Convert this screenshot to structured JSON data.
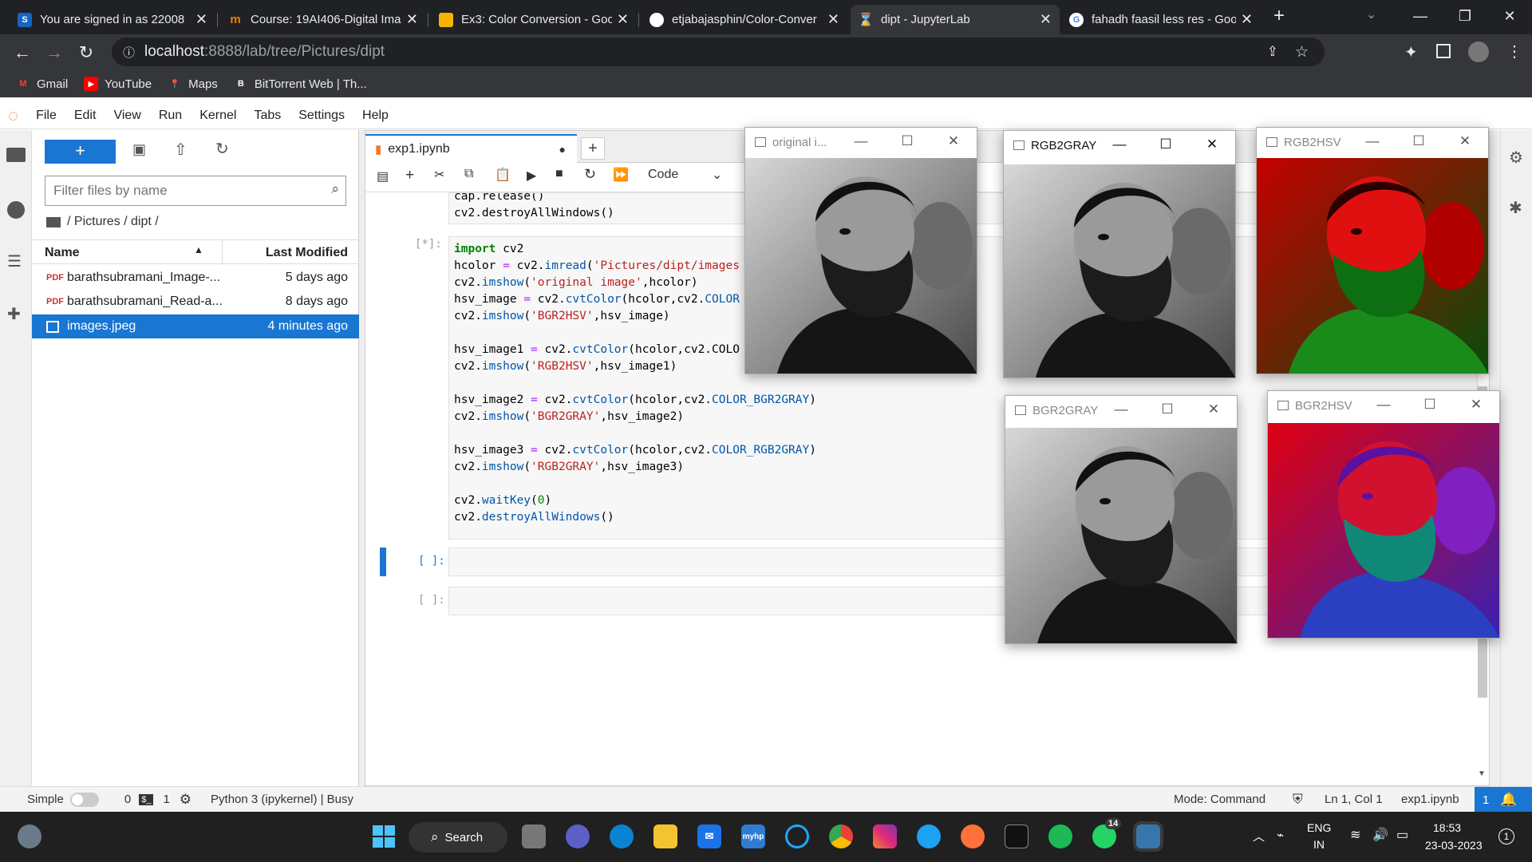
{
  "browser": {
    "tabs": [
      {
        "title": "You are signed in as 22008",
        "favicon": "S",
        "color": "#1565c0",
        "active": false
      },
      {
        "title": "Course: 19AI406-Digital Ima",
        "favicon": "m",
        "color": "#f57c00",
        "active": false
      },
      {
        "title": "Ex3: Color Conversion - Goo",
        "favicon": "",
        "color": "#f4b400",
        "active": false
      },
      {
        "title": "etjabajasphin/Color-Conver",
        "favicon": "",
        "color": "#ffffff",
        "active": false
      },
      {
        "title": "dipt - JupyterLab",
        "favicon": "",
        "color": "#f37726",
        "active": true
      },
      {
        "title": "fahadh faasil less res - Goo",
        "favicon": "G",
        "color": "#4285f4",
        "active": false
      }
    ],
    "url_host": "localhost",
    "url_path": ":8888/lab/tree/Pictures/dipt",
    "bookmarks": [
      {
        "label": "Gmail",
        "icon": "M",
        "color": "#ea4335"
      },
      {
        "label": "YouTube",
        "icon": "▶",
        "color": "#ff0000"
      },
      {
        "label": "Maps",
        "icon": "◆",
        "color": "#34a853"
      },
      {
        "label": "BitTorrent Web | Th...",
        "icon": "B",
        "color": "#ffffff"
      }
    ]
  },
  "jupyter": {
    "menu": [
      "File",
      "Edit",
      "View",
      "Run",
      "Kernel",
      "Tabs",
      "Settings",
      "Help"
    ],
    "filter_placeholder": "Filter files by name",
    "breadcrumb": "/ Pictures / dipt /",
    "col_name": "Name",
    "col_modified": "Last Modified",
    "files": [
      {
        "name": "barathsubramani_Image-...",
        "modified": "5 days ago",
        "type": "pdf",
        "selected": false
      },
      {
        "name": "barathsubramani_Read-a...",
        "modified": "8 days ago",
        "type": "pdf",
        "selected": false
      },
      {
        "name": "images.jpeg",
        "modified": "4 minutes ago",
        "type": "image",
        "selected": true
      }
    ],
    "notebook_tab": "exp1.ipynb",
    "cell_type": "Code",
    "prompt_running": "[*]:",
    "prompt_empty": "[ ]:",
    "status": {
      "mode_label": "Simple",
      "count0": "0",
      "count1": "1",
      "kernel": "Python 3 (ipykernel) | Busy",
      "mode": "Mode: Command",
      "position": "Ln 1, Col 1",
      "file": "exp1.ipynb",
      "notif": "1"
    }
  },
  "code_prev": [
    "cap.release()",
    "cv2.destroyAllWindows()"
  ],
  "code_main": [
    "import cv2",
    "hcolor = cv2.imread('Pictures/dipt/images",
    "cv2.imshow('original image',hcolor)",
    "hsv_image = cv2.cvtColor(hcolor,cv2.COLOR",
    "cv2.imshow('BGR2HSV',hsv_image)",
    "",
    "hsv_image1 = cv2.cvtColor(hcolor,cv2.COLO",
    "cv2.imshow('RGB2HSV',hsv_image1)",
    "",
    "hsv_image2 = cv2.cvtColor(hcolor,cv2.COLOR_BGR2GRAY)",
    "cv2.imshow('BGR2GRAY',hsv_image2)",
    "",
    "hsv_image3 = cv2.cvtColor(hcolor,cv2.COLOR_RGB2GRAY)",
    "cv2.imshow('RGB2GRAY',hsv_image3)",
    "",
    "cv2.waitKey(0)",
    "cv2.destroyAllWindows()"
  ],
  "cv_windows": [
    {
      "title": "original i...",
      "kind": "gray",
      "active": false
    },
    {
      "title": "RGB2GRAY",
      "kind": "gray",
      "active": true
    },
    {
      "title": "RGB2HSV",
      "kind": "hsv1",
      "active": false
    },
    {
      "title": "BGR2GRAY",
      "kind": "gray",
      "active": false
    },
    {
      "title": "BGR2HSV",
      "kind": "hsv2",
      "active": false
    }
  ],
  "taskbar": {
    "search_label": "Search",
    "lang1": "ENG",
    "lang2": "IN",
    "time": "18:53",
    "date": "23-03-2023",
    "whatsapp_badge": "14",
    "notif_count": "1"
  }
}
